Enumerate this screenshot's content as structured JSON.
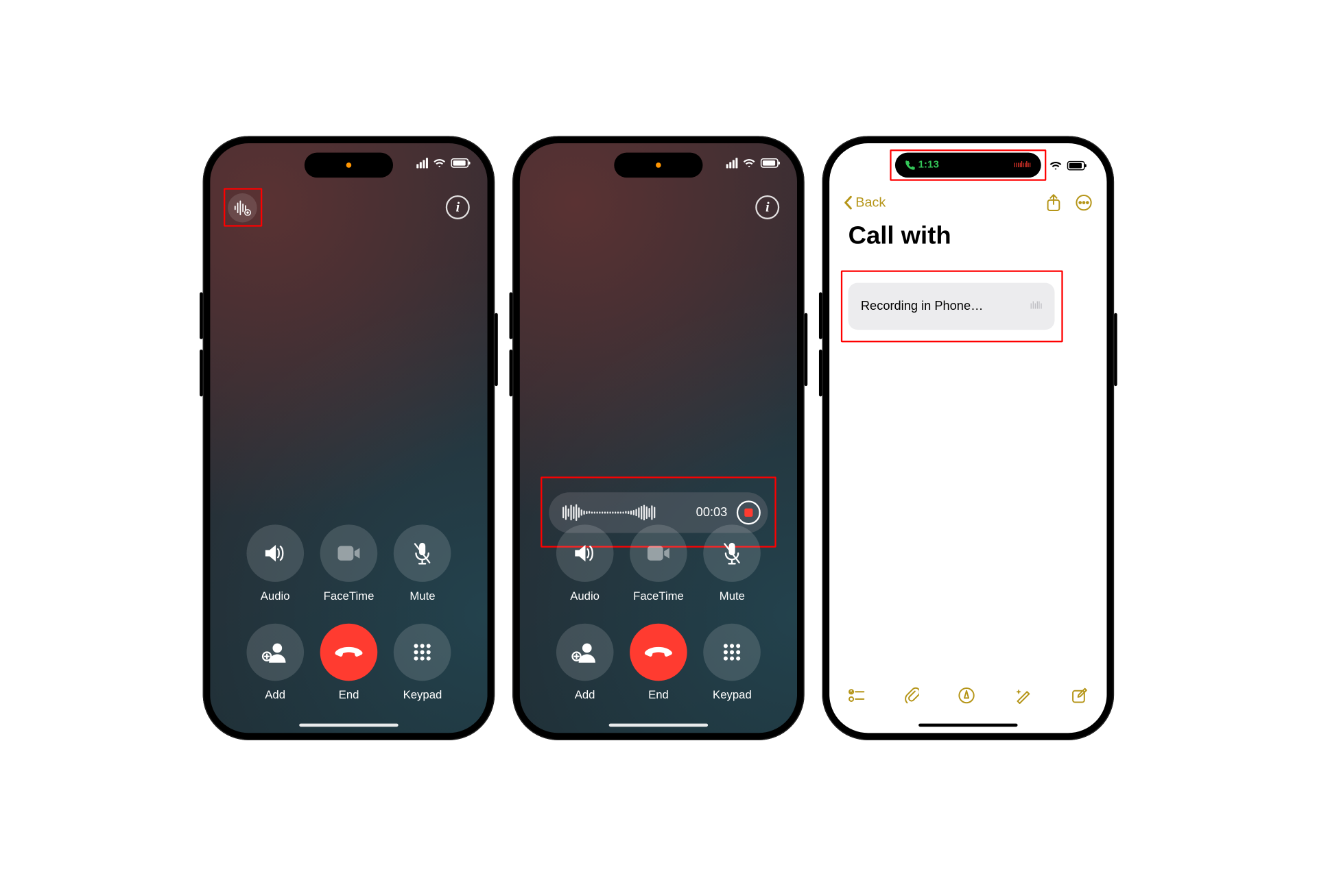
{
  "phone1": {
    "controls": {
      "audio": "Audio",
      "facetime": "FaceTime",
      "mute": "Mute",
      "add": "Add",
      "end": "End",
      "keypad": "Keypad"
    }
  },
  "phone2": {
    "recording_timer": "00:03",
    "controls": {
      "audio": "Audio",
      "facetime": "FaceTime",
      "mute": "Mute",
      "add": "Add",
      "end": "End",
      "keypad": "Keypad"
    }
  },
  "phone3": {
    "island_time": "1:13",
    "back_label": "Back",
    "note_title": "Call with",
    "attachment_label": "Recording in Phone…"
  }
}
